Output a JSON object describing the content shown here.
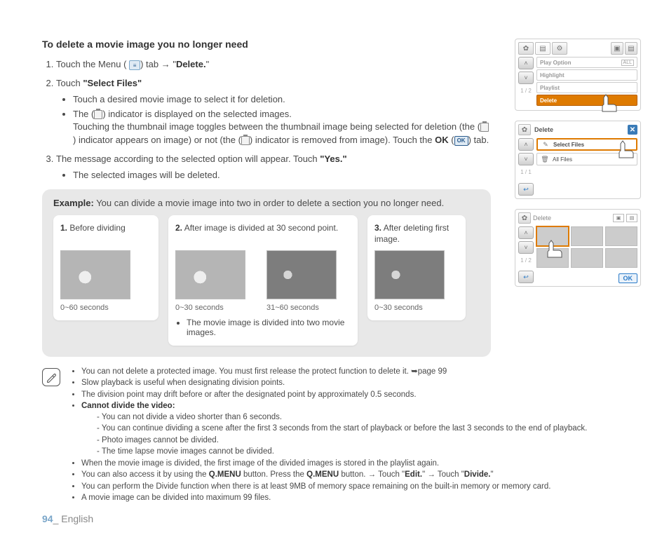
{
  "heading": "To delete a movie image you no longer need",
  "steps": {
    "s1_a": "Touch the Menu (",
    "s1_b": ") tab → \"",
    "s1_bold": "Delete.",
    "s1_c": "\"",
    "s2_a": "Touch ",
    "s2_bold": "\"Select Files\"",
    "s2_bullets": {
      "b1": "Touch a desired movie image to select it for deletion.",
      "b2a": "The (",
      "b2b": ") indicator is displayed on the selected images.",
      "b3a": "Touching the thumbnail image toggles between the thumbnail image being selected for deletion (the (",
      "b3b": ") indicator appears on image) or not (the (",
      "b3c": ") indicator is removed from image). Touch the ",
      "b3_ok": "OK",
      "b3d": " (",
      "b3e": ") tab."
    },
    "s3_a": "The message according to the selected option will appear. Touch ",
    "s3_bold": "\"Yes.\"",
    "s3_bullets": {
      "b1": "The selected images will be deleted."
    }
  },
  "example": {
    "lead_bold": "Example:",
    "lead": " You can divide a movie image into two in order to delete a section you no longer need.",
    "c1": {
      "num": "1.",
      "cap": "Before dividing",
      "t1": "0~60 seconds"
    },
    "c2": {
      "num": "2.",
      "cap": "After image is divided at 30 second point.",
      "t1": "0~30 seconds",
      "t2": "31~60 seconds",
      "note": "The movie image is divided into two movie images."
    },
    "c3": {
      "num": "3.",
      "cap": "After deleting first image.",
      "t1": "0~30 seconds"
    }
  },
  "notes": {
    "n1": "You can not delete a protected image. You must first release the protect function to delete it. ➥page 99",
    "n2": "Slow playback is useful when designating division points.",
    "n3": "The division point may drift before or after the designated point by approximately 0.5 seconds.",
    "n4_bold": "Cannot divide the video:",
    "n4d1": "You can not divide a video shorter than 6 seconds.",
    "n4d2": "You can continue dividing a scene after the first 3 seconds from the start of playback or before the last 3 seconds to the end of playback.",
    "n4d3": "Photo images cannot be divided.",
    "n4d4": "The time lapse movie images cannot be divided.",
    "n5": "When the movie image is divided, the first image of the divided images is stored in the playlist again.",
    "n6a": "You can also access it by using the ",
    "n6b": "Q.MENU",
    "n6c": " button. Press the ",
    "n6d": "Q.MENU",
    "n6e": " button. → Touch \"",
    "n6f": "Edit.",
    "n6g": "\" → Touch \"",
    "n6h": "Divide.",
    "n6i": "\"",
    "n7": "You can perform the Divide function when there is at least 9MB of memory space remaining on the built-in memory or memory card.",
    "n8": "A movie image can be divided into maximum 99 files."
  },
  "footer": {
    "page": "94",
    "sep": "_ ",
    "lang": "English"
  },
  "lcd1": {
    "pages": "1 / 2",
    "items": {
      "a": "Play Option",
      "b": "Highlight",
      "c": "Playlist",
      "d": "Delete"
    },
    "badge": "ALL"
  },
  "lcd2": {
    "title": "Delete",
    "pages": "1 / 1",
    "sel": "Select Files",
    "all": "All Files"
  },
  "lcd3": {
    "title": "Delete",
    "pages": "1 / 2",
    "ok": "OK"
  }
}
